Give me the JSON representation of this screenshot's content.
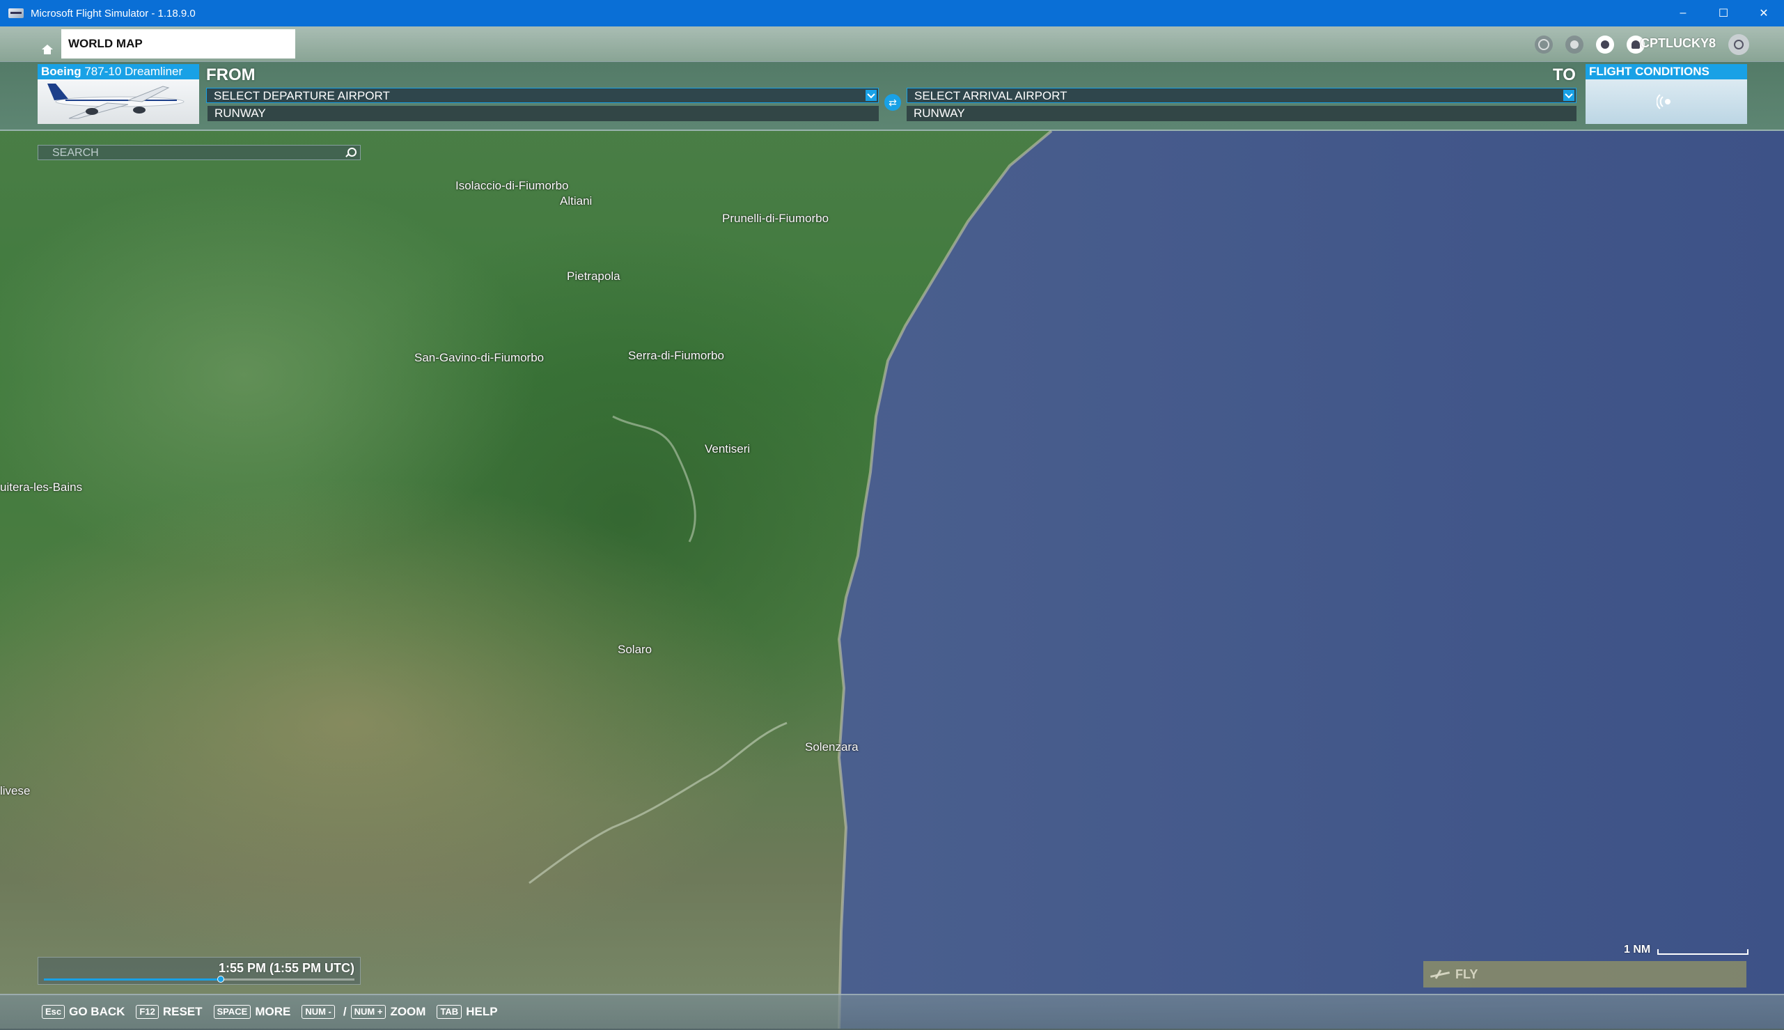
{
  "window": {
    "title": "Microsoft Flight Simulator - 1.18.9.0",
    "controls": [
      "–",
      "☐",
      "✕"
    ]
  },
  "nav": {
    "tab_label": "WORLD MAP",
    "username": "CPTLUCKY8"
  },
  "aircraft": {
    "brand": "Boeing",
    "model": "787-10 Dreamliner"
  },
  "plan": {
    "from_label": "FROM",
    "to_label": "TO",
    "departure_placeholder": "SELECT DEPARTURE AIRPORT",
    "arrival_placeholder": "SELECT ARRIVAL AIRPORT",
    "departure_runway": "RUNWAY",
    "arrival_runway": "RUNWAY",
    "flight_conditions": "FLIGHT CONDITIONS"
  },
  "search": {
    "placeholder": "SEARCH"
  },
  "map": {
    "places": [
      "Isolaccio-di-Fiumorbo",
      "Altiani",
      "Prunelli-di-Fiumorbo",
      "Pietrapola",
      "San-Gavino-di-Fiumorbo",
      "Serra-di-Fiumorbo",
      "Ventiseri",
      "uitera-les-Bains",
      "Solaro",
      "Solenzara",
      "livese"
    ],
    "scale_label": "1 NM"
  },
  "time": {
    "label": "1:55 PM (1:55 PM UTC)",
    "progress": 0.57
  },
  "fly": {
    "label": "FLY"
  },
  "hints": [
    {
      "key": "Esc",
      "label": "GO BACK"
    },
    {
      "key": "F12",
      "label": "RESET"
    },
    {
      "key": "SPACE",
      "label": "MORE"
    },
    {
      "key": "NUM -",
      "key2": "NUM +",
      "label": "ZOOM"
    },
    {
      "key": "TAB",
      "label": "HELP"
    }
  ],
  "colors": {
    "accent": "#19a1e6",
    "titlebar": "#0a6fd6",
    "sea": "#3f5488"
  }
}
